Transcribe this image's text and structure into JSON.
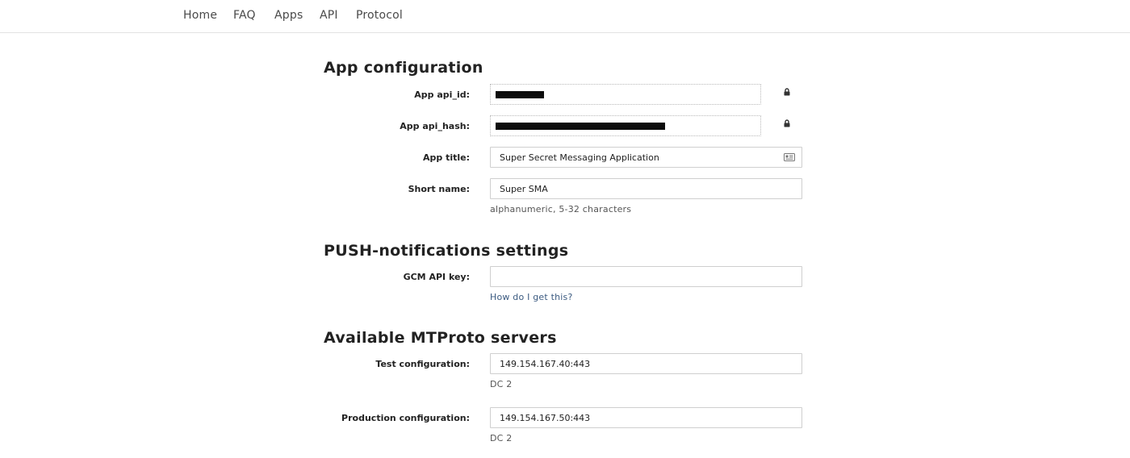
{
  "nav": {
    "items": [
      "Home",
      "FAQ",
      "Apps",
      "API",
      "Protocol"
    ]
  },
  "sections": {
    "app_config": "App configuration",
    "push": "PUSH-notifications settings",
    "mtproto": "Available MTProto servers"
  },
  "form": {
    "api_id_label": "App api_id:",
    "api_hash_label": "App api_hash:",
    "title_label": "App title:",
    "title_value": "Super Secret Messaging Application",
    "short_label": "Short name:",
    "short_value": "Super SMA",
    "short_hint": "alphanumeric, 5-32 characters",
    "gcm_label": "GCM API key:",
    "gcm_value": "",
    "gcm_hint": "How do I get this?",
    "test_label": "Test configuration:",
    "test_value": "149.154.167.40:443",
    "test_hint": "DC 2",
    "prod_label": "Production configuration:",
    "prod_value": "149.154.167.50:443",
    "prod_hint": "DC 2"
  },
  "icons": {
    "locked_fields": "lock-icon",
    "title_field": "id-card-icon"
  }
}
